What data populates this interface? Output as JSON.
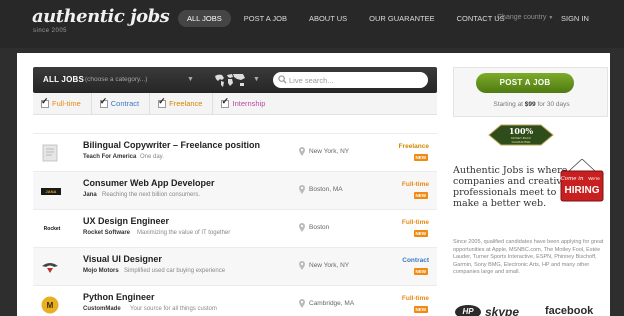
{
  "header": {
    "logo": "authentic jobs",
    "logo_sub": "since 2005",
    "nav": [
      {
        "label": "ALL JOBS",
        "active": true
      },
      {
        "label": "POST A JOB",
        "active": false
      },
      {
        "label": "ABOUT US",
        "active": false
      },
      {
        "label": "OUR GUARANTEE",
        "active": false
      },
      {
        "label": "CONTACT US",
        "active": false
      }
    ],
    "change_country": "Change country",
    "change_country_icon": "chevron-down-icon",
    "sign_in": "SIGN IN"
  },
  "search": {
    "all_jobs": "ALL JOBS",
    "category_hint": "(choose a category...)",
    "map_icon": "world-map-icon",
    "placeholder": "Live search..."
  },
  "filters": [
    {
      "label": "Full-time",
      "checked": true,
      "color": "#e88a14"
    },
    {
      "label": "Contract",
      "checked": true,
      "color": "#3a78c2"
    },
    {
      "label": "Freelance",
      "checked": true,
      "color": "#d08a00"
    },
    {
      "label": "Internship",
      "checked": true,
      "color": "#b84aa4"
    }
  ],
  "jobs": [
    {
      "title": "Bilingual Copywriter – Freelance position",
      "company": "Teach For America",
      "desc": "One day.",
      "location": "New York, NY",
      "type": "Freelance",
      "type_color": "#d08a00",
      "badge": "NEW",
      "logo_icon": "document-icon"
    },
    {
      "title": "Consumer Web App Developer",
      "company": "Jana",
      "desc": "Reaching the next billion consumers.",
      "location": "Boston, MA",
      "type": "Full-time",
      "type_color": "#e88a14",
      "badge": "NEW",
      "logo_icon": "jana-logo-icon"
    },
    {
      "title": "UX Design Engineer",
      "company": "Rocket Software",
      "desc": "Maximizing the value of IT together",
      "location": "Boston",
      "type": "Full-time",
      "type_color": "#e88a14",
      "badge": "NEW",
      "logo_icon": "rocket-logo-icon",
      "logo_text": "Rocket"
    },
    {
      "title": "Visual UI Designer",
      "company": "Mojo Motors",
      "desc": "Simplified used car buying experience",
      "location": "New York, NY",
      "type": "Contract",
      "type_color": "#3a78c2",
      "badge": "NEW",
      "logo_icon": "mojo-logo-icon"
    },
    {
      "title": "Python Engineer",
      "company": "CustomMade",
      "desc": "Your source for all things custom",
      "location": "Cambridge, MA",
      "type": "Full-time",
      "type_color": "#e88a14",
      "badge": "NEW",
      "logo_icon": "custommade-logo-icon"
    }
  ],
  "sidebar": {
    "post_button": "POST A JOB",
    "price_prefix": "Starting at ",
    "price": "$99",
    "price_suffix": " for 30 days",
    "guarantee_badge": [
      "100%",
      "MONEY-BACK",
      "GUARANTEE"
    ],
    "tagline": "Authentic Jobs is where companies and creative professionals meet to make a better web.",
    "hiring_sign": [
      "Come in",
      "We're",
      "HIRING"
    ],
    "blurb": "Since 2005, qualified candidates have been applying for great opportunities at Apple, MSNBC.com, The Motley Fool, Estée Lauder, Turner Sports Interactive, ESPN, Phinney Bischoff, Garmin, Sony BMG, Electronic Arts, HP and many other companies large and small.",
    "brands": [
      "HP",
      "skype",
      "facebook"
    ]
  }
}
